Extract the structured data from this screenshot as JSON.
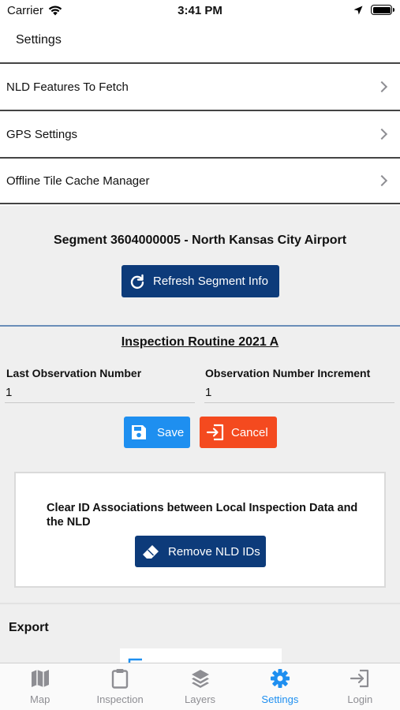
{
  "status": {
    "carrier": "Carrier",
    "time": "3:41 PM"
  },
  "nav": {
    "title": "Settings"
  },
  "menu": [
    {
      "label": "NLD Features To Fetch"
    },
    {
      "label": "GPS Settings"
    },
    {
      "label": "Offline Tile Cache Manager"
    }
  ],
  "segment": {
    "title": "Segment 3604000005 - North Kansas City Airport",
    "refresh_label": "Refresh Segment Info"
  },
  "routine": {
    "title": "Inspection Routine 2021 A",
    "last_obs_label": "Last Observation Number",
    "last_obs_value": "1",
    "increment_label": "Observation Number Increment",
    "increment_value": "1",
    "save_label": "Save",
    "cancel_label": "Cancel"
  },
  "clear_card": {
    "text": "Clear ID Associations between Local Inspection Data and the NLD",
    "button_label": "Remove NLD IDs"
  },
  "export": {
    "label": "Export"
  },
  "tabs": [
    {
      "label": "Map",
      "icon": "map-icon",
      "active": false
    },
    {
      "label": "Inspection",
      "icon": "clipboard-icon",
      "active": false
    },
    {
      "label": "Layers",
      "icon": "layers-icon",
      "active": false
    },
    {
      "label": "Settings",
      "icon": "gear-icon",
      "active": true
    },
    {
      "label": "Login",
      "icon": "login-icon",
      "active": false
    }
  ],
  "colors": {
    "navy_button": "#0d3b7a",
    "save_button": "#1e8ff0",
    "cancel_button": "#f44a1f",
    "active_tab": "#1e8ff0",
    "inactive_tab": "#8e8e93"
  }
}
